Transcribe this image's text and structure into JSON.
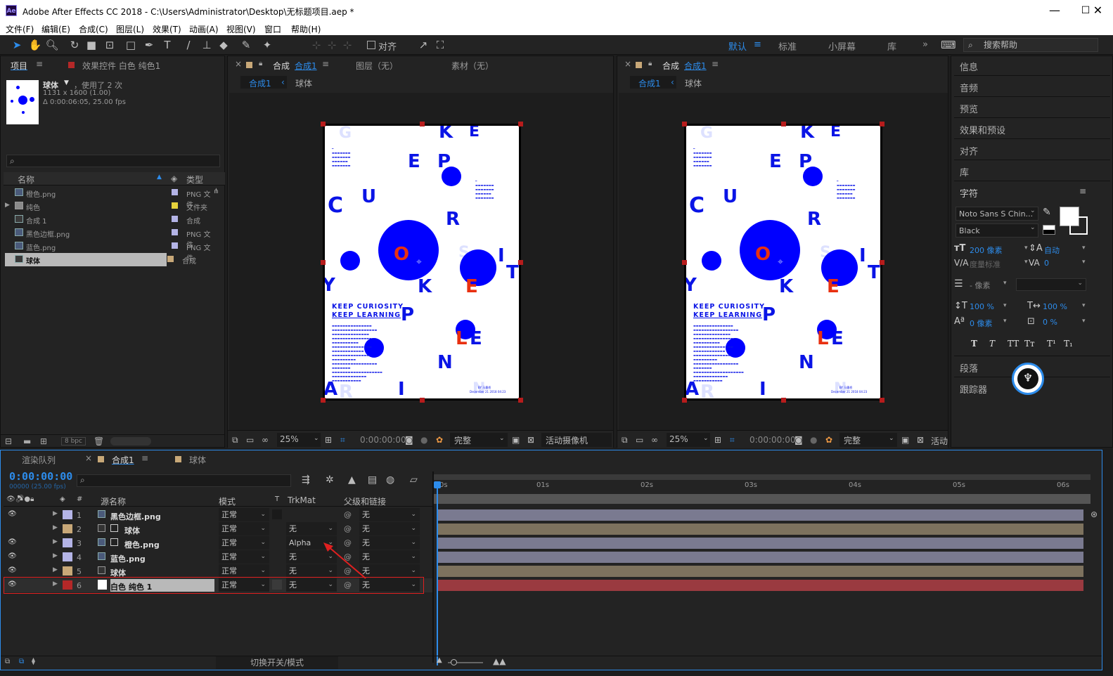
{
  "window": {
    "title": "Adobe After Effects CC 2018 - C:\\Users\\Administrator\\Desktop\\无标题项目.aep *",
    "app_badge": "Ae",
    "controls": [
      "—",
      "☐",
      "✕"
    ]
  },
  "menu": [
    "文件(F)",
    "编辑(E)",
    "合成(C)",
    "图层(L)",
    "效果(T)",
    "动画(A)",
    "视图(V)",
    "窗口",
    "帮助(H)"
  ],
  "toolbar": {
    "align_label": "对齐",
    "workspaces": [
      "默认",
      "标准",
      "小屏幕",
      "库"
    ],
    "active_workspace": "默认",
    "search_placeholder": "搜索帮助"
  },
  "project": {
    "tab": "项目",
    "effects_tab": "效果控件 白色 纯色1",
    "selected_name": "球体",
    "usage": "，使用了 2 次",
    "dims": "1131 x 1600 (1.00)",
    "duration": "Δ 0:00:06:05, 25.00 fps",
    "col_name": "名称",
    "col_type": "类型",
    "bpc": "8 bpc",
    "items": [
      {
        "name": "橙色.png",
        "type": "PNG 文件",
        "label": "#b4b4e6"
      },
      {
        "name": "纯色",
        "type": "文件夹",
        "label": "#e6d23c"
      },
      {
        "name": "合成 1",
        "type": "合成",
        "label": "#b4b4e6"
      },
      {
        "name": "黑色边框.png",
        "type": "PNG 文件",
        "label": "#b4b4e6"
      },
      {
        "name": "蓝色.png",
        "type": "PNG 文件",
        "label": "#b4b4e6"
      },
      {
        "name": "球体",
        "type": "合成",
        "label": "#c8a878"
      }
    ]
  },
  "viewer1": {
    "tab_prefix": "合成",
    "tab_comp": "合成1",
    "tab_layer": "图层（无）",
    "tab_footage": "素材（无）",
    "crumb_comp": "合成1",
    "crumb_layer": "球体",
    "zoom": "25%",
    "time": "0:00:00:00",
    "quality": "完整",
    "camera": "活动摄像机"
  },
  "viewer2": {
    "tab_prefix": "合成",
    "tab_comp": "合成1",
    "crumb_comp": "合成1",
    "crumb_layer": "球体",
    "zoom": "25%",
    "time": "0:00:00:00",
    "quality": "完整",
    "camera": "活动"
  },
  "poster": {
    "headline1": "KEEP CURIOSITY",
    "headline2": "KEEP LEARNING",
    "letters": [
      "G",
      "K",
      "E",
      "E",
      "P",
      "C",
      "U",
      "R",
      "O",
      "S",
      "I",
      "T",
      "Y",
      "K",
      "E",
      "P",
      "L",
      "E",
      "N",
      "A",
      "R",
      "I",
      "N"
    ],
    "author": "BY 马墨桥",
    "date": "December 21 2018 04:23"
  },
  "right_panel": {
    "items": [
      "信息",
      "音频",
      "预览",
      "效果和预设",
      "对齐",
      "库"
    ],
    "character": "字符",
    "font": "Noto Sans S Chin...",
    "style": "Black",
    "size": "200 像素",
    "leading": "自动",
    "kerning": "度量标准",
    "tracking": "0",
    "stroke": "- 像素",
    "vscale": "100 %",
    "hscale": "100 %",
    "baseline": "0 像素",
    "tsume": "0 %",
    "paragraph": "段落",
    "tracker": "跟踪器",
    "text_styles": [
      "T",
      "T",
      "TT",
      "Tт",
      "T¹",
      "T₁"
    ]
  },
  "timeline": {
    "tab_render": "渲染队列",
    "tab_comp": "合成1",
    "tab_sphere": "球体",
    "timecode": "0:00:00:00",
    "frames": "00000 (25.00 fps)",
    "col_source": "源名称",
    "col_mode": "模式",
    "col_t": "T",
    "col_trk": "TrkMat",
    "col_parent": "父级和链接",
    "toggle_label": "切换开关/模式",
    "ruler": [
      "0s",
      "01s",
      "02s",
      "03s",
      "04s",
      "05s",
      "06s"
    ],
    "layers": [
      {
        "num": "1",
        "name": "黑色边框.png",
        "mode": "正常",
        "trk": "",
        "parent": "无",
        "label": "#b4b4e6",
        "bar": "#7a7a90"
      },
      {
        "num": "2",
        "name": "球体",
        "mode": "正常",
        "trk": "无",
        "parent": "无",
        "label": "#c8a878",
        "bar": "#7d725e"
      },
      {
        "num": "3",
        "name": "橙色.png",
        "mode": "正常",
        "trk": "Alpha",
        "parent": "无",
        "label": "#b4b4e6",
        "bar": "#7a7a90"
      },
      {
        "num": "4",
        "name": "蓝色.png",
        "mode": "正常",
        "trk": "无",
        "parent": "无",
        "label": "#b4b4e6",
        "bar": "#7a7a90"
      },
      {
        "num": "5",
        "name": "球体",
        "mode": "正常",
        "trk": "无",
        "parent": "无",
        "label": "#c8a878",
        "bar": "#7d725e"
      },
      {
        "num": "6",
        "name": "白色 纯色 1",
        "mode": "正常",
        "trk": "无",
        "parent": "无",
        "label": "#b42828",
        "bar": "#9a3a40"
      }
    ]
  },
  "colors": {
    "accent": "#2d8ceb",
    "annotation": "#e02020"
  }
}
